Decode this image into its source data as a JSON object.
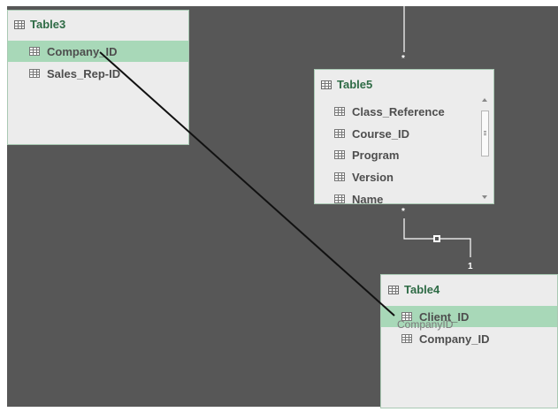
{
  "tables": {
    "table3": {
      "title": "Table3",
      "fields": [
        "Company_ID",
        "Sales_Rep-ID"
      ]
    },
    "table5": {
      "title": "Table5",
      "fields": [
        "Class_Reference",
        "Course_ID",
        "Program",
        "Version",
        "Name"
      ]
    },
    "table4": {
      "title": "Table4",
      "fields": [
        "Client_ID",
        "Company_ID"
      ]
    }
  },
  "relationships": {
    "table5_top_cardinality": "*",
    "table5_bottom_cardinality": "*",
    "table4_cardinality": "1"
  },
  "drag": {
    "tooltip": "CompanyID"
  },
  "colors": {
    "canvas": "#575757",
    "card": "#ececec",
    "title": "#2e6b45",
    "selected_field": "#a8d8b8",
    "relationship_line": "#ffffff",
    "drag_line": "#111111"
  }
}
